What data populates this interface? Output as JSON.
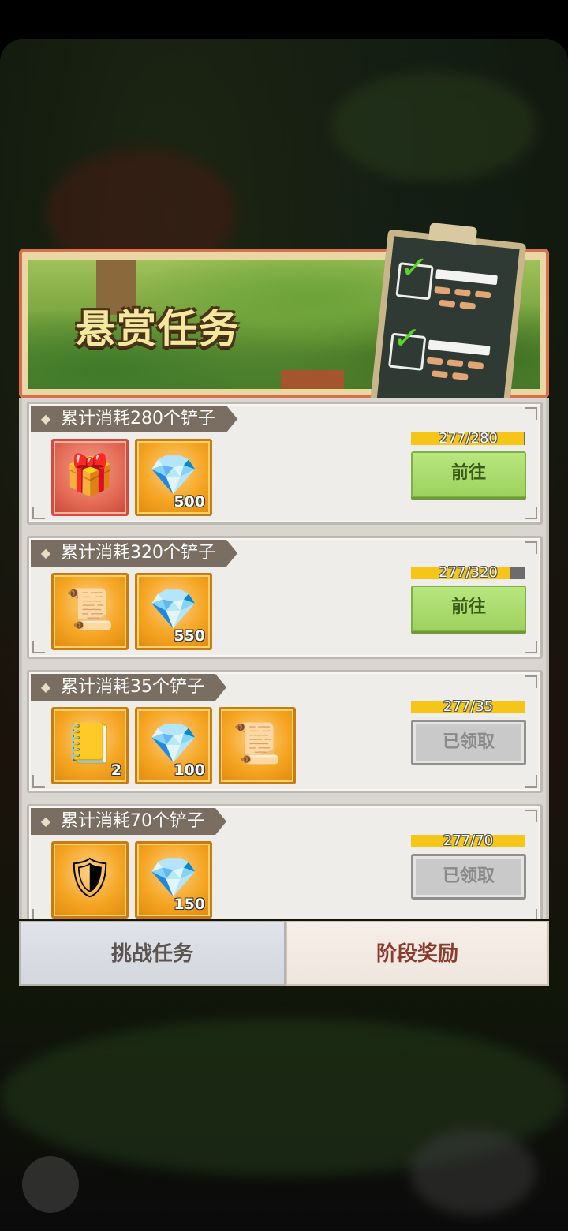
{
  "banner": {
    "title": "悬赏任务"
  },
  "tasks": [
    {
      "label": "累计消耗280个铲子",
      "progress": {
        "text": "277/280",
        "current": 277,
        "total": 280
      },
      "button": "前往",
      "status": "go",
      "rewards": [
        {
          "icon": "mystery-chest-icon",
          "glyph": "🎁",
          "qty": ""
        },
        {
          "icon": "diamond-icon",
          "glyph": "💎",
          "qty": "500"
        }
      ]
    },
    {
      "label": "累计消耗320个铲子",
      "progress": {
        "text": "277/320",
        "current": 277,
        "total": 320
      },
      "button": "前往",
      "status": "go",
      "rewards": [
        {
          "icon": "scroll-card-icon",
          "glyph": "📜",
          "qty": ""
        },
        {
          "icon": "diamond-icon",
          "glyph": "💎",
          "qty": "550"
        }
      ]
    },
    {
      "label": "累计消耗35个铲子",
      "progress": {
        "text": "277/35",
        "current": 35,
        "total": 35
      },
      "button": "已领取",
      "status": "claimed",
      "rewards": [
        {
          "icon": "golden-book-icon",
          "glyph": "📒",
          "qty": "2"
        },
        {
          "icon": "diamond-icon",
          "glyph": "💎",
          "qty": "100"
        },
        {
          "icon": "scroll-card-icon",
          "glyph": "📜",
          "qty": ""
        }
      ]
    },
    {
      "label": "累计消耗70个铲子",
      "progress": {
        "text": "277/70",
        "current": 70,
        "total": 70
      },
      "button": "已领取",
      "status": "claimed",
      "rewards": [
        {
          "icon": "armor-chest-icon",
          "glyph": "🛡",
          "qty": ""
        },
        {
          "icon": "diamond-icon",
          "glyph": "💎",
          "qty": "150"
        }
      ]
    }
  ],
  "tabs": {
    "left": "挑战任务",
    "right": "阶段奖励"
  },
  "colors": {
    "progress_fill": "#f5c518",
    "go_button": "#9ed25e",
    "tag_bg": "#7a6d61"
  }
}
